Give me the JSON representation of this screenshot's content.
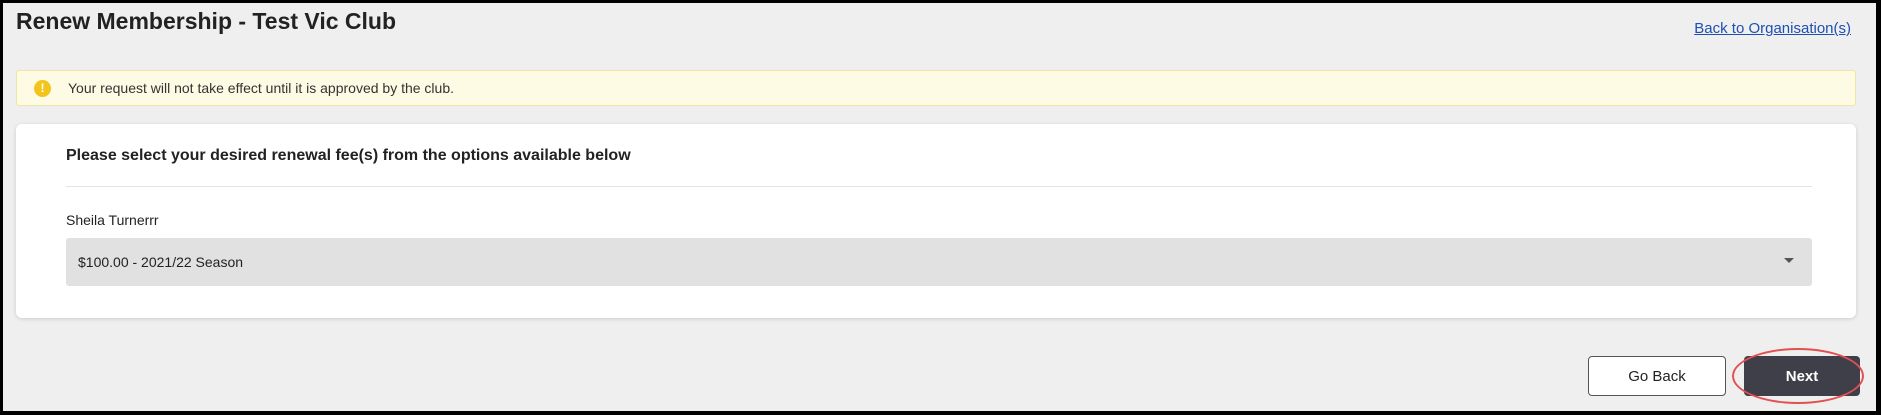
{
  "header": {
    "title": "Renew Membership - Test Vic Club",
    "back_link": "Back to Organisation(s)"
  },
  "notice": {
    "icon": "exclamation-icon",
    "icon_glyph": "!",
    "text": "Your request will not take effect until it is approved by the club.",
    "color": "#f2c41c"
  },
  "form": {
    "heading": "Please select your desired renewal fee(s) from the options available below",
    "member_name": "Sheila Turnerrr",
    "selected_fee": "$100.00 - 2021/22 Season"
  },
  "actions": {
    "back_label": "Go Back",
    "next_label": "Next",
    "next_highlight_color": "#e25050"
  }
}
